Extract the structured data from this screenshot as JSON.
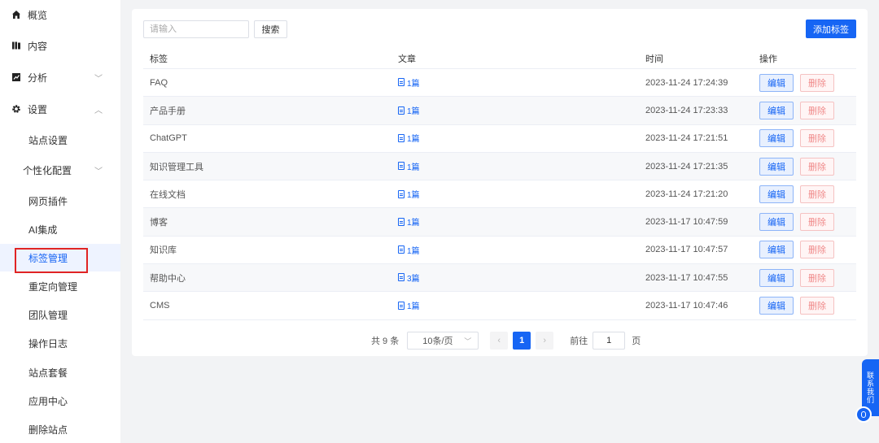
{
  "sidebar": {
    "items": [
      {
        "key": "overview",
        "label": "概览",
        "icon": "home-icon"
      },
      {
        "key": "content",
        "label": "内容",
        "icon": "book-icon"
      },
      {
        "key": "analytics",
        "label": "分析",
        "icon": "chart-icon",
        "chevron": "down"
      },
      {
        "key": "settings",
        "label": "设置",
        "icon": "gear-icon",
        "chevron": "up"
      },
      {
        "key": "site_settings",
        "label": "站点设置"
      },
      {
        "key": "personalization",
        "label": "个性化配置",
        "chevron": "down"
      },
      {
        "key": "web_plugin",
        "label": "网页插件"
      },
      {
        "key": "ai_integration",
        "label": "AI集成"
      },
      {
        "key": "tag_management",
        "label": "标签管理",
        "active": true
      },
      {
        "key": "redirect_management",
        "label": "重定向管理"
      },
      {
        "key": "team_management",
        "label": "团队管理"
      },
      {
        "key": "operation_log",
        "label": "操作日志"
      },
      {
        "key": "site_plan",
        "label": "站点套餐"
      },
      {
        "key": "app_center",
        "label": "应用中心"
      },
      {
        "key": "delete_site",
        "label": "删除站点"
      }
    ]
  },
  "toolbar": {
    "search_placeholder": "请输入",
    "search_value": "",
    "search_label": "搜索",
    "add_label": "添加标签"
  },
  "table": {
    "headers": {
      "tag": "标签",
      "article": "文章",
      "time": "时间",
      "ops": "操作"
    },
    "edit_label": "编辑",
    "delete_label": "删除",
    "rows": [
      {
        "tag": "FAQ",
        "article": "1篇",
        "time": "2023-11-24 17:24:39"
      },
      {
        "tag": "产品手册",
        "article": "1篇",
        "time": "2023-11-24 17:23:33"
      },
      {
        "tag": "ChatGPT",
        "article": "1篇",
        "time": "2023-11-24 17:21:51"
      },
      {
        "tag": "知识管理工具",
        "article": "1篇",
        "time": "2023-11-24 17:21:35"
      },
      {
        "tag": "在线文档",
        "article": "1篇",
        "time": "2023-11-24 17:21:20"
      },
      {
        "tag": "博客",
        "article": "1篇",
        "time": "2023-11-17 10:47:59"
      },
      {
        "tag": "知识库",
        "article": "1篇",
        "time": "2023-11-17 10:47:57"
      },
      {
        "tag": "帮助中心",
        "article": "3篇",
        "time": "2023-11-17 10:47:55"
      },
      {
        "tag": "CMS",
        "article": "1篇",
        "time": "2023-11-17 10:47:46"
      }
    ]
  },
  "pagination": {
    "total": "共 9 条",
    "page_size": "10条/页",
    "prev": "‹",
    "current": "1",
    "next": "›",
    "goto_label": "前往",
    "goto_value": "1",
    "page_suffix": "页"
  },
  "contact": {
    "label": "联系我们"
  },
  "colors": {
    "accent": "#1665f4",
    "highlight_box": "#e02424",
    "danger_text": "#f08a8a"
  }
}
